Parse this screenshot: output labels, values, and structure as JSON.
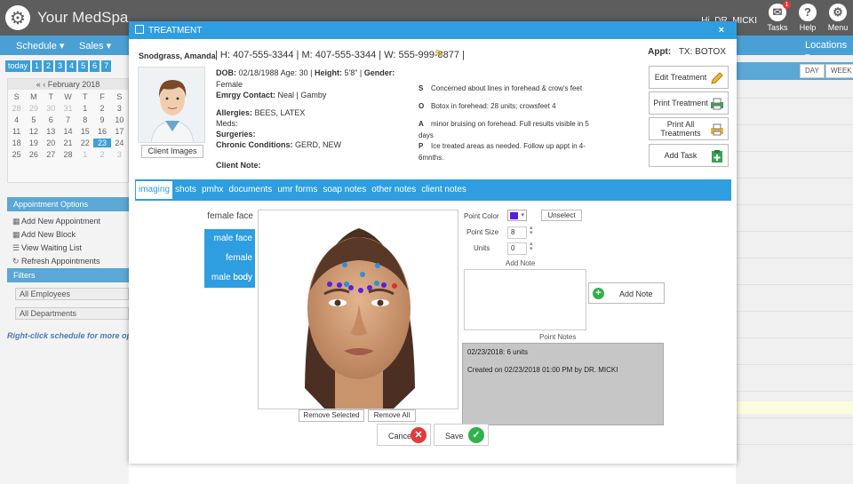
{
  "app": {
    "brand": "Your MedSpa",
    "user": "Hi, DR. MICKI",
    "top_icons": [
      {
        "icon": "tasks-icon",
        "label": "Tasks",
        "badge": "1"
      },
      {
        "icon": "help-icon",
        "label": "Help"
      },
      {
        "icon": "menu-icon",
        "label": "Menu"
      }
    ],
    "nav": {
      "schedule": "Schedule ▾",
      "sales": "Sales ▾",
      "locations": "Locations ▾"
    }
  },
  "left": {
    "today": "today",
    "day_numbers": [
      "1",
      "2",
      "3",
      "4",
      "5",
      "6",
      "7"
    ],
    "calendar": {
      "month": "February 2018",
      "weekdays": [
        "S",
        "M",
        "T",
        "W",
        "T",
        "F",
        "S"
      ],
      "rows": [
        [
          "28",
          "29",
          "30",
          "31",
          "1",
          "2",
          "3"
        ],
        [
          "4",
          "5",
          "6",
          "7",
          "8",
          "9",
          "10"
        ],
        [
          "11",
          "12",
          "13",
          "14",
          "15",
          "16",
          "17"
        ],
        [
          "18",
          "19",
          "20",
          "21",
          "22",
          "23",
          "24"
        ],
        [
          "25",
          "26",
          "27",
          "28",
          "1",
          "2",
          "3"
        ]
      ]
    },
    "appointment_options": "Appointment Options",
    "links": [
      "Add New Appointment",
      "Add New Block",
      "View Waiting List",
      "Refresh Appointments"
    ],
    "filters": "Filters",
    "employees": "All Employees",
    "departments": "All Departments",
    "right_click_hint": "Right-click schedule for more options"
  },
  "right": {
    "day": "DAY",
    "week": "WEEK"
  },
  "modal": {
    "title": "TREATMENT",
    "close": "×",
    "patient_name": "Snodgrass, Amanda",
    "phones": "| H: 407-555-3344 | M: 407-555-3344 | W: 555-999-8877 |",
    "appt_label": "Appt:",
    "appt_value": "TX: BOTOX",
    "client_images": "Client Images",
    "info": {
      "dob_label": "DOB:",
      "dob_value": "02/18/1988 Age: 30 |",
      "height_label": "Height:",
      "height_value": "5'8\" |",
      "gender_label": "Gender:",
      "gender_value": "Female",
      "emergency_label": "Emrgy Contact:",
      "emergency_value": "Neal | Gamby",
      "allergies_label": "Allergies:",
      "allergies_value": "BEES, LATEX",
      "meds_label": "Meds:",
      "surgeries_label": "Surgeries:",
      "chronic_label": "Chronic Conditions:",
      "chronic_value": "GERD, NEW",
      "client_note_label": "Client Note:"
    },
    "soap": [
      {
        "k": "S",
        "v": "Concerned about lines in forehead & crow's feet"
      },
      {
        "k": "O",
        "v": "Botox in forehead: 28 units; crowsfeet 4"
      },
      {
        "k": "A",
        "v": "minor bruising on forehead. Full results visible in 5 days"
      },
      {
        "k": "P",
        "v": "Ice treated areas as needed. Follow up appt in 4-6mnths."
      }
    ],
    "actions": [
      {
        "label": "Edit Treatment",
        "icon": "pencil-icon"
      },
      {
        "label": "Print Treatment",
        "icon": "printer-icon"
      },
      {
        "label": "Print All Treatments",
        "icon": "printer-all-icon"
      },
      {
        "label": "Add Task",
        "icon": "add-task-icon"
      }
    ],
    "tabs": [
      "imaging",
      "shots",
      "pmhx",
      "documents",
      "umr forms",
      "soap notes",
      "other notes",
      "client notes"
    ],
    "image_list_label": "female face",
    "image_list": [
      "male face",
      "female body",
      "male body"
    ],
    "remove_selected": "Remove Selected",
    "remove_all": "Remove All",
    "point_color_label": "Point Color",
    "point_color": "#5a1ee0",
    "unselect": "Unselect",
    "point_size_label": "Point Size",
    "point_size": "8",
    "units_label": "Units",
    "units": "0",
    "add_note_label": "Add Note",
    "add_note_button": "Add Note",
    "point_notes_label": "Point Notes",
    "point_notes_line1": "02/23/2018: 6 units",
    "point_notes_line2": "Created on 02/23/2018 01:00 PM by DR. MICKI",
    "cancel": "Cancel",
    "save": "Save"
  }
}
